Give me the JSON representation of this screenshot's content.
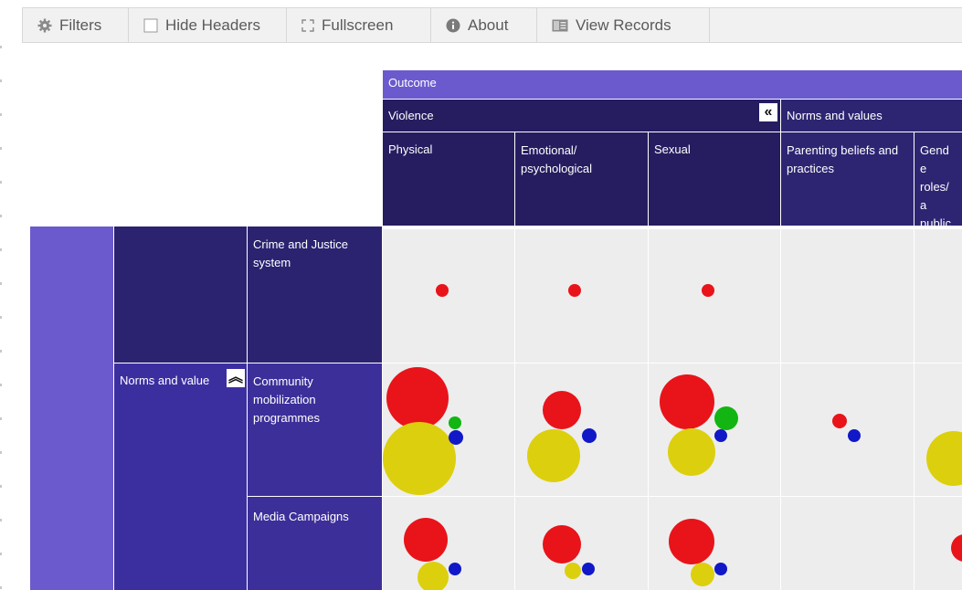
{
  "toolbar": {
    "filters": "Filters",
    "hide_headers": "Hide Headers",
    "fullscreen": "Fullscreen",
    "about": "About",
    "view_records": "View Records"
  },
  "columns": {
    "outcome": "Outcome",
    "violence": "Violence",
    "norms": "Norms and values",
    "physical": "Physical",
    "emotional": "Emotional/ psychological",
    "sexual": "Sexual",
    "parenting": "Parenting beliefs and practices",
    "gender": "Gende roles/a public"
  },
  "rows": {
    "norms_group": "Norms and value",
    "crime": "Crime and Justice system",
    "community": "Community mobilization programmes",
    "media": "Media Campaigns"
  },
  "colors": {
    "red": "#e8141a",
    "yellow": "#dccf0e",
    "green": "#12b512",
    "blue": "#1018c8"
  }
}
